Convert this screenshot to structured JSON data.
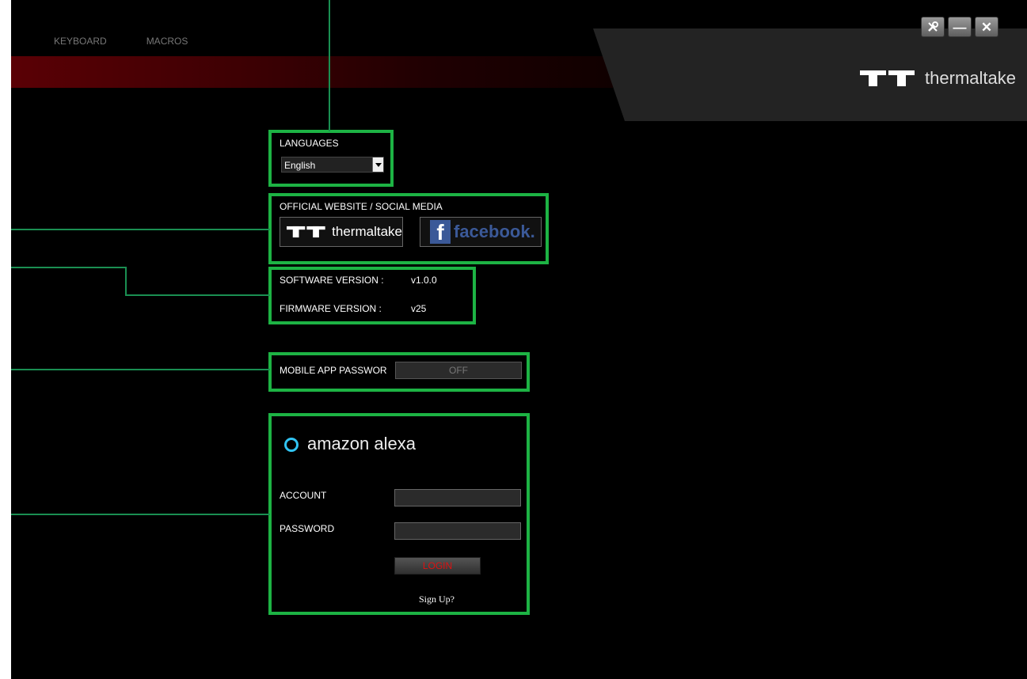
{
  "nav": {
    "tabs": [
      {
        "label": "KEYBOARD"
      },
      {
        "label": "MACROS"
      }
    ]
  },
  "brand": {
    "logo_text": "thermaltake"
  },
  "window_controls": {
    "icons": [
      "tools-icon",
      "minimize-icon",
      "close-icon"
    ],
    "minimize_glyph": "—",
    "close_glyph": "✕"
  },
  "languages": {
    "heading": "LANGUAGES",
    "selected": "English"
  },
  "official": {
    "heading": "OFFICIAL WEBSITE / SOCIAL MEDIA",
    "thermaltake_label": "thermaltake",
    "facebook_glyph": "f",
    "facebook_label": "facebook."
  },
  "versions": {
    "software_label": "SOFTWARE VERSION :",
    "software_value": "v1.0.0",
    "firmware_label": "FIRMWARE VERSION :",
    "firmware_value": "v25"
  },
  "mobile": {
    "label": "MOBILE APP PASSWOR",
    "toggle_state": "OFF"
  },
  "alexa": {
    "title": "amazon alexa",
    "account_label": "ACCOUNT",
    "account_value": "",
    "password_label": "PASSWORD",
    "password_value": "",
    "login_label": "LOGIN",
    "signup_label": "Sign Up?"
  },
  "colors": {
    "highlight_box": "#1db344",
    "callout_line": "#1a8f52",
    "alexa_ring": "#31c4f3",
    "facebook_blue": "#3b5998",
    "login_text": "#dd1111"
  }
}
